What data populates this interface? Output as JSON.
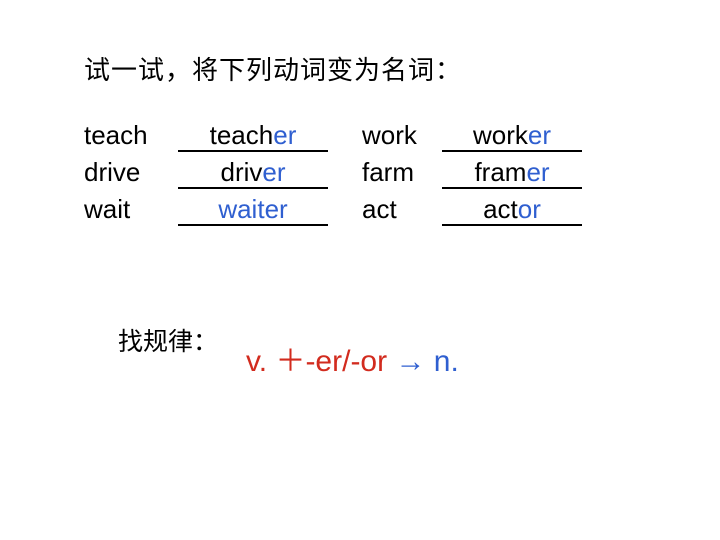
{
  "slide": {
    "title": "试一试，将下列动词变为名词：",
    "rows": [
      {
        "left_verb": "teach",
        "left_noun_stem": "teach",
        "left_noun_suffix": "er",
        "right_verb": "work",
        "right_noun_stem": "work",
        "right_noun_suffix": "er"
      },
      {
        "left_verb": "drive",
        "left_noun_stem": "driv",
        "left_noun_suffix": "er",
        "right_verb": "farm",
        "right_noun_stem": "fram",
        "right_noun_suffix": "er"
      },
      {
        "left_verb": "wait",
        "left_noun_stem": "wait",
        "left_noun_suffix": "er",
        "right_verb": "act",
        "right_noun_stem": "act",
        "right_noun_suffix": "or"
      }
    ],
    "rule": {
      "label": "找规律：",
      "formula": "v. ＋-er/-or",
      "arrow": " → ",
      "result": "n."
    }
  }
}
